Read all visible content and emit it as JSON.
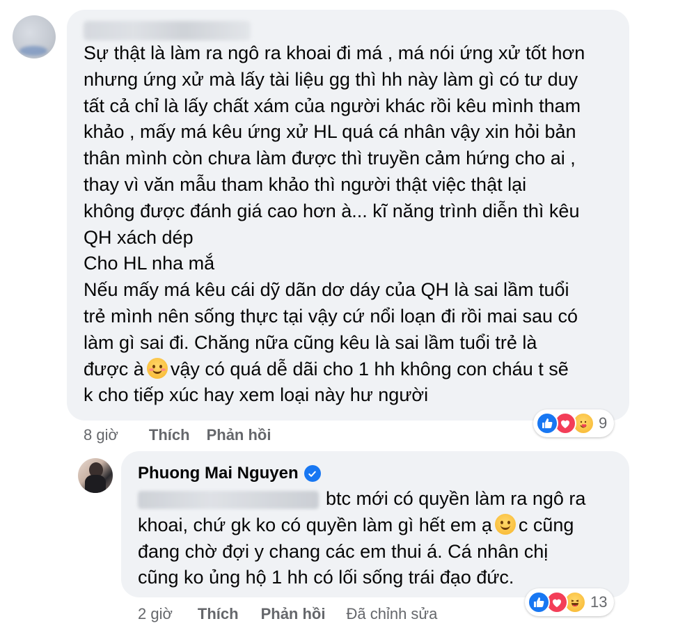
{
  "comment_1": {
    "text": "Sự thật là làm ra ngô ra khoai đi má , má nói ứng xử tốt hơn\nnhưng ứng xử mà lấy tài liệu gg thì hh này làm gì có tư duy\ntất cả chỉ là lấy chất xám của người khác rồi kêu mình tham\nkhảo , mấy má kêu ứng xử HL quá cá nhân vậy xin hỏi bản\nthân mình còn chưa làm được thì truyền cảm hứng cho ai ,\nthay vì văn mẫu tham khảo thì người thật việc thật lại\nkhông được đánh giá cao hơn à... kĩ năng trình diễn thì kêu\nQH xách dép\nCho HL nha mắ\nNếu mấy má kêu cái dỹ dãn dơ dáy của QH là sai lầm tuổi\ntrẻ mình nên sống thực tại vậy cứ nổi loạn đi rồi mai sau có\nlàm gì sai đi. Chăng nữa cũng kêu là sai lầm tuổi trẻ là",
    "text_emoji_before": "được à",
    "text_emoji_after": "vậy có quá dễ dãi cho 1 hh không con cháu t sẽ\nk cho tiếp xúc hay xem loại này hư người",
    "time": "8 giờ",
    "like_label": "Thích",
    "reply_label": "Phản hồi",
    "reaction_count": "9",
    "reaction_icons": [
      "like-icon",
      "love-icon",
      "care-icon"
    ]
  },
  "reply_1": {
    "author": "Phuong Mai Nguyen",
    "text_line1": "btc mới có quyền làm ra ngô ra",
    "text_line2_before": "khoai, chứ gk ko có quyền làm gì hết em ạ",
    "text_line2_after": "c cũng",
    "text_rest": "đang chờ đợi y chang các em thui á. Cá nhân chị\ncũng ko ủng hộ 1 hh có lối sống trái đạo đức.",
    "time": "2 giờ",
    "like_label": "Thích",
    "reply_label": "Phản hồi",
    "edited_label": "Đã chỉnh sửa",
    "reaction_count": "13",
    "reaction_icons": [
      "like-icon",
      "love-icon",
      "haha-icon"
    ]
  },
  "colors": {
    "bubble": "#f0f2f5",
    "text": "#050505",
    "secondary": "#65676b",
    "like": "#1877f2",
    "love": "#f33e58"
  }
}
